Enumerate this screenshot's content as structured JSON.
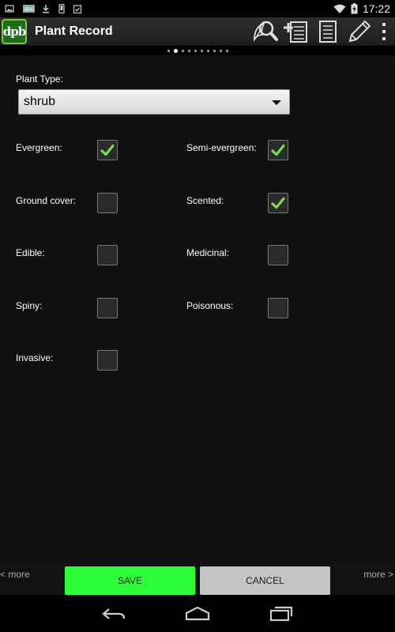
{
  "status_bar": {
    "time": "17:22",
    "left_icons": [
      "image-icon",
      "app-notification-icon",
      "download-icon",
      "device-icon",
      "clipboard-check-icon"
    ],
    "right_icons": [
      "wifi-icon",
      "battery-charging-icon"
    ]
  },
  "action_bar": {
    "logo_text": "dpb",
    "title": "Plant Record",
    "actions": [
      "search-plant-icon",
      "add-list-icon",
      "list-icon",
      "edit-pencil-icon",
      "overflow-menu-icon"
    ]
  },
  "pager": {
    "total": 10,
    "active_index": 1
  },
  "form": {
    "plant_type_label": "Plant Type:",
    "plant_type_value": "shrub",
    "checkboxes": [
      {
        "label": "Evergreen:",
        "checked": true
      },
      {
        "label": "Semi-evergreen:",
        "checked": true
      },
      {
        "label": "Ground cover:",
        "checked": false
      },
      {
        "label": "Scented:",
        "checked": true
      },
      {
        "label": "Edible:",
        "checked": false
      },
      {
        "label": "Medicinal:",
        "checked": false
      },
      {
        "label": "Spiny:",
        "checked": false
      },
      {
        "label": "Poisonous:",
        "checked": false
      },
      {
        "label": "Invasive:",
        "checked": false
      }
    ]
  },
  "bottom_bar": {
    "more_left": "< more",
    "more_right": "more >",
    "save_label": "SAVE",
    "cancel_label": "CANCEL"
  },
  "colors": {
    "save_button": "#2cff38",
    "cancel_button": "#c4c4c4",
    "check_mark": "#7ed957",
    "logo_bg": "#1f6d1a"
  }
}
